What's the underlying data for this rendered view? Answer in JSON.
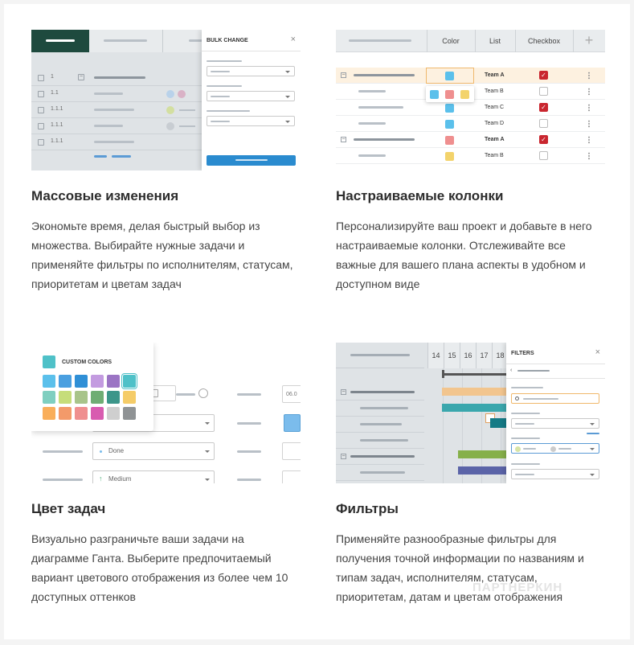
{
  "features": [
    {
      "title": "Массовые изменения",
      "description": "Экономьте время, делая быстрый выбор из множества. Выбирайте нужные задачи и применяйте фильтры по исполнителям, статусам, приоритетам и цветам задач",
      "panel_title": "BULK CHANGE",
      "rows": [
        "1",
        "1.1",
        "1.1.1",
        "1.1.1",
        "1.1.1"
      ]
    },
    {
      "title": "Настраиваемые колонки",
      "description": "Персонализируйте ваш проект и добавьте в него настраиваемые колонки. Отслеживайте все важные для вашего плана аспекты в удобном и доступном виде",
      "columns": [
        "Color",
        "List",
        "Checkbox"
      ],
      "add_column": "+",
      "teams": [
        "Team A",
        "Team B",
        "Team C",
        "Team D",
        "Team A",
        "Team B"
      ]
    },
    {
      "title": "Цвет задач",
      "description": "Визуально разграничьте ваши задачи на диаграмме Ганта. Выберите предпочитаемый вариант цветового отображения из более чем 10 доступных оттенков",
      "panel_title": "CUSTOM COLORS",
      "status_value": "Done",
      "priority_value": "Medium",
      "date_value": "06.0"
    },
    {
      "title": "Фильтры",
      "description": "Применяйте разнообразные фильтры для получения точной информации по названиям и типам задач, исполнителям, статусам, приоритетам, датам и цветам отображения",
      "panel_title": "FILTERS",
      "days": [
        "14",
        "15",
        "16",
        "17",
        "18"
      ]
    }
  ],
  "watermark": "ПАРТНЕРКИН",
  "colors": {
    "accent_dark_green": "#1e4a3e",
    "button_blue": "#2a8bcf",
    "checkbox_red": "#c9262f",
    "highlight_row": "#fdf1e0"
  }
}
